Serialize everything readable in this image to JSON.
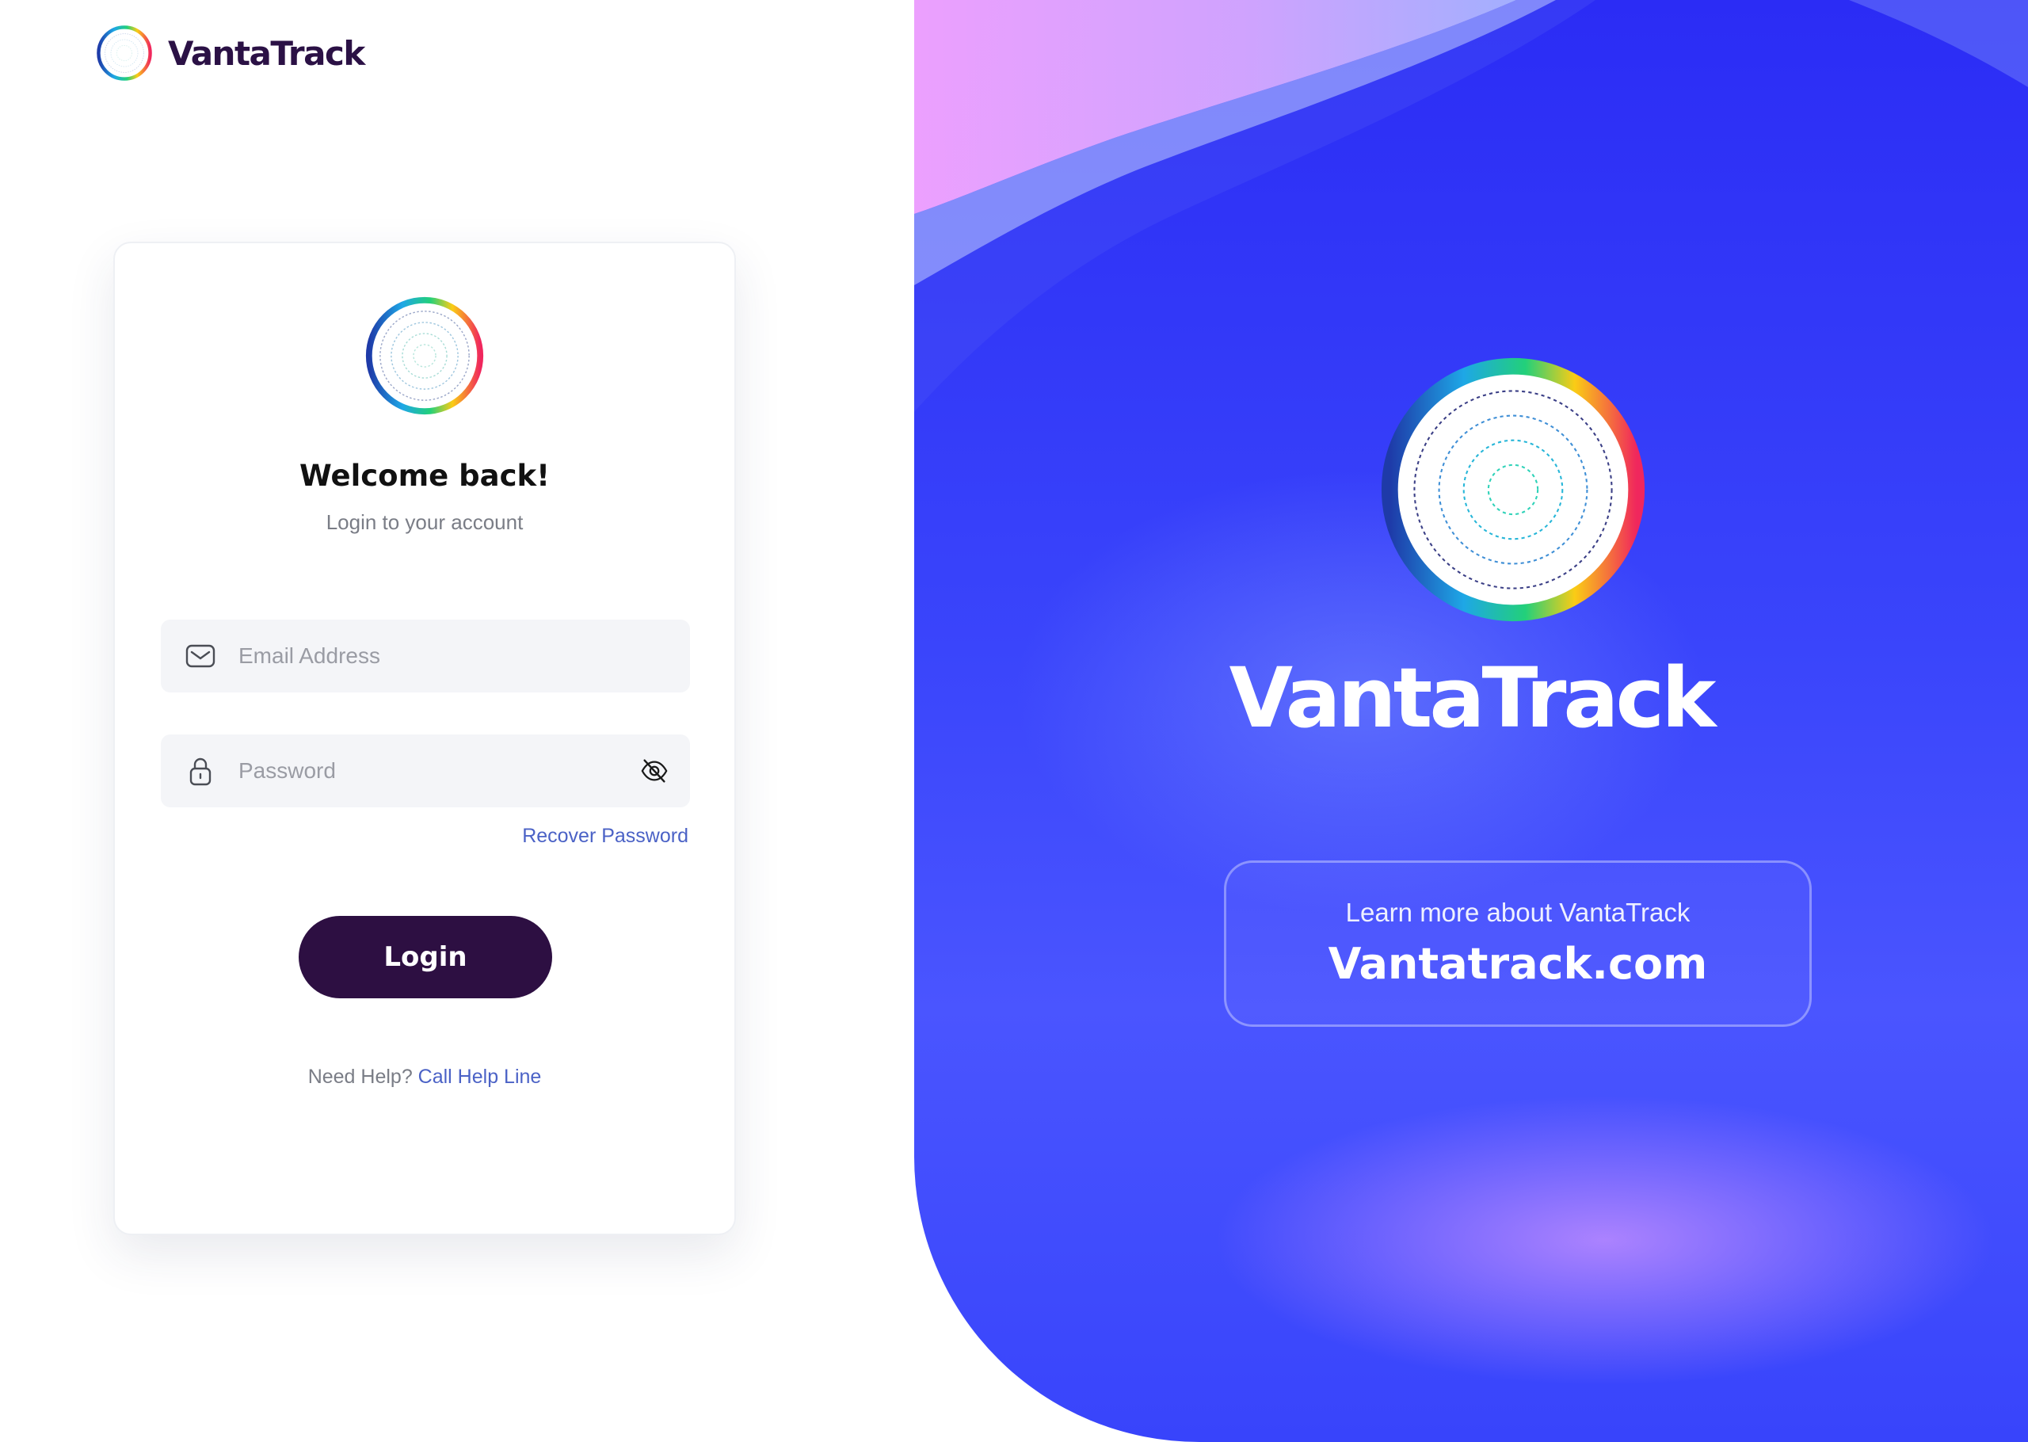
{
  "brand": {
    "name": "VantaTrack",
    "logo_icon": "rainbow-ring-logo-icon"
  },
  "login": {
    "welcome": "Welcome back!",
    "subtitle": "Login to your account",
    "email": {
      "placeholder": "Email Address",
      "value": "",
      "icon": "envelope-icon"
    },
    "password": {
      "placeholder": "Password",
      "value": "",
      "icon": "lock-icon",
      "toggle_icon": "eye-off-icon"
    },
    "recover_label": "Recover Password",
    "login_label": "Login",
    "help_prefix": "Need Help?",
    "help_link": "Call Help Line"
  },
  "hero": {
    "brand_name": "VantaTrack",
    "learn_more": "Learn more about VantaTrack",
    "url_label": "Vantatrack.com"
  },
  "colors": {
    "brand_dark": "#2d0f42",
    "link_blue": "#4b62c6",
    "hero_blue": "#3a45fb",
    "field_bg": "#f4f5f8"
  }
}
